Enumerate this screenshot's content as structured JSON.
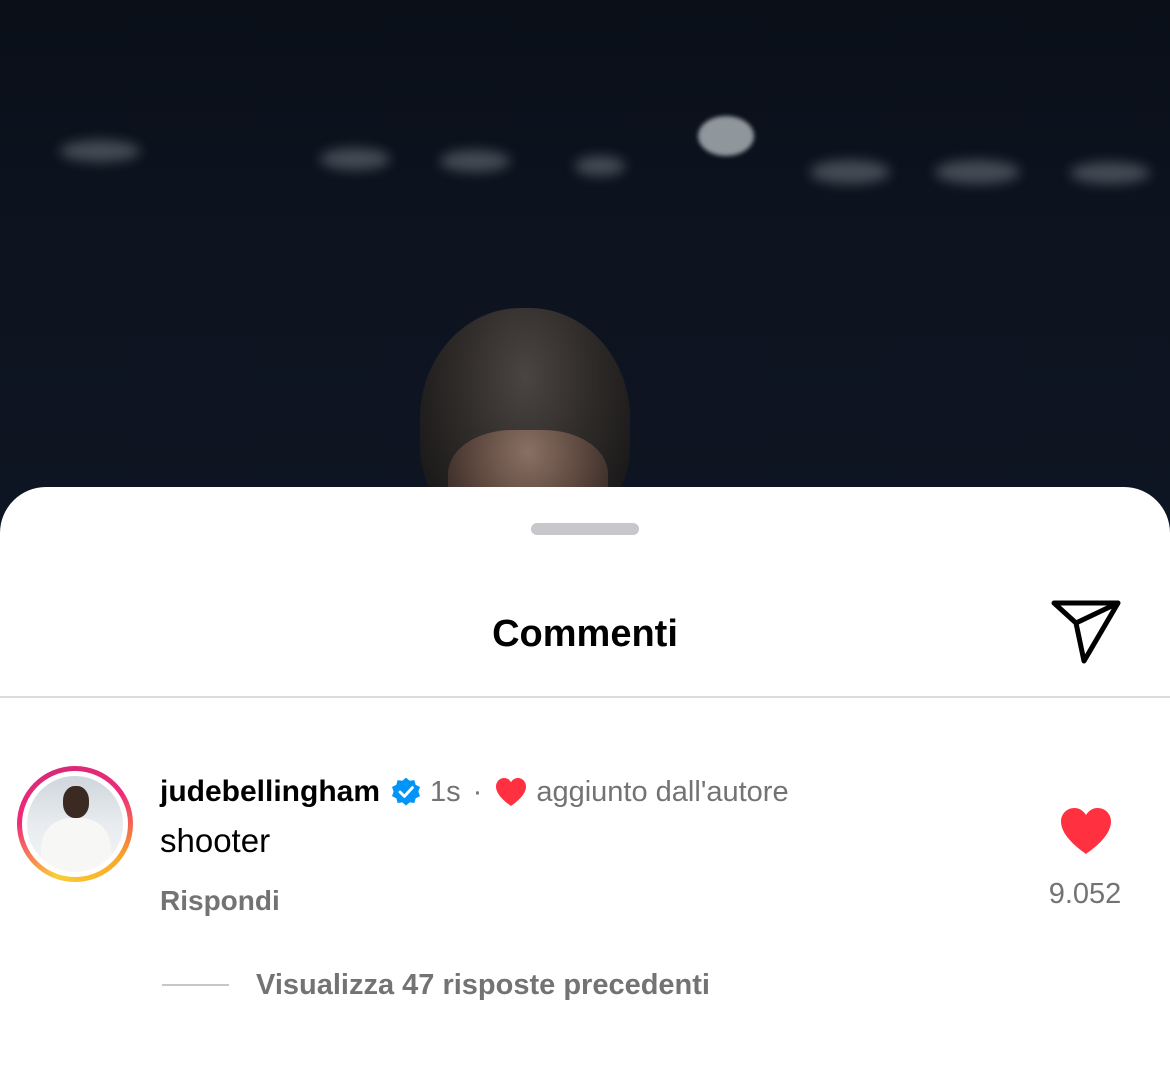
{
  "sheet": {
    "title": "Commenti",
    "share_icon": "paper-plane-icon"
  },
  "comment": {
    "username": "judebellingham",
    "verified_icon": "verified-badge-icon",
    "time": "1s",
    "separator": "·",
    "author_liked_icon": "heart-icon",
    "author_liked_text": "aggiunto dall'autore",
    "text": "shooter",
    "reply_label": "Rispondi",
    "like_icon": "heart-icon",
    "like_count": "9.052",
    "view_replies_label": "Visualizza 47 risposte precedenti"
  },
  "colors": {
    "heart": "#ff3040",
    "verified": "#0095f6",
    "secondary_text": "#737373"
  }
}
